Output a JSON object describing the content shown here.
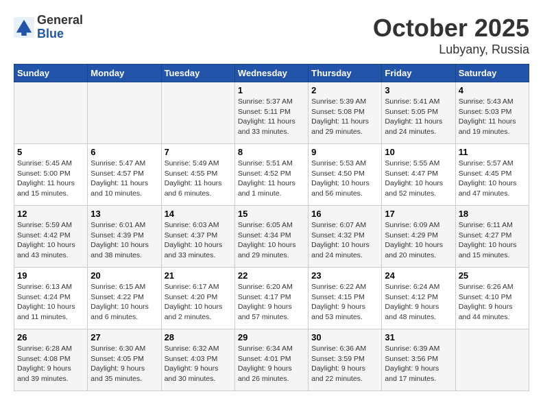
{
  "header": {
    "logo_line1": "General",
    "logo_line2": "Blue",
    "month": "October 2025",
    "location": "Lubyany, Russia"
  },
  "weekdays": [
    "Sunday",
    "Monday",
    "Tuesday",
    "Wednesday",
    "Thursday",
    "Friday",
    "Saturday"
  ],
  "weeks": [
    [
      {
        "day": "",
        "info": ""
      },
      {
        "day": "",
        "info": ""
      },
      {
        "day": "",
        "info": ""
      },
      {
        "day": "1",
        "info": "Sunrise: 5:37 AM\nSunset: 5:11 PM\nDaylight: 11 hours\nand 33 minutes."
      },
      {
        "day": "2",
        "info": "Sunrise: 5:39 AM\nSunset: 5:08 PM\nDaylight: 11 hours\nand 29 minutes."
      },
      {
        "day": "3",
        "info": "Sunrise: 5:41 AM\nSunset: 5:05 PM\nDaylight: 11 hours\nand 24 minutes."
      },
      {
        "day": "4",
        "info": "Sunrise: 5:43 AM\nSunset: 5:03 PM\nDaylight: 11 hours\nand 19 minutes."
      }
    ],
    [
      {
        "day": "5",
        "info": "Sunrise: 5:45 AM\nSunset: 5:00 PM\nDaylight: 11 hours\nand 15 minutes."
      },
      {
        "day": "6",
        "info": "Sunrise: 5:47 AM\nSunset: 4:57 PM\nDaylight: 11 hours\nand 10 minutes."
      },
      {
        "day": "7",
        "info": "Sunrise: 5:49 AM\nSunset: 4:55 PM\nDaylight: 11 hours\nand 6 minutes."
      },
      {
        "day": "8",
        "info": "Sunrise: 5:51 AM\nSunset: 4:52 PM\nDaylight: 11 hours\nand 1 minute."
      },
      {
        "day": "9",
        "info": "Sunrise: 5:53 AM\nSunset: 4:50 PM\nDaylight: 10 hours\nand 56 minutes."
      },
      {
        "day": "10",
        "info": "Sunrise: 5:55 AM\nSunset: 4:47 PM\nDaylight: 10 hours\nand 52 minutes."
      },
      {
        "day": "11",
        "info": "Sunrise: 5:57 AM\nSunset: 4:45 PM\nDaylight: 10 hours\nand 47 minutes."
      }
    ],
    [
      {
        "day": "12",
        "info": "Sunrise: 5:59 AM\nSunset: 4:42 PM\nDaylight: 10 hours\nand 43 minutes."
      },
      {
        "day": "13",
        "info": "Sunrise: 6:01 AM\nSunset: 4:39 PM\nDaylight: 10 hours\nand 38 minutes."
      },
      {
        "day": "14",
        "info": "Sunrise: 6:03 AM\nSunset: 4:37 PM\nDaylight: 10 hours\nand 33 minutes."
      },
      {
        "day": "15",
        "info": "Sunrise: 6:05 AM\nSunset: 4:34 PM\nDaylight: 10 hours\nand 29 minutes."
      },
      {
        "day": "16",
        "info": "Sunrise: 6:07 AM\nSunset: 4:32 PM\nDaylight: 10 hours\nand 24 minutes."
      },
      {
        "day": "17",
        "info": "Sunrise: 6:09 AM\nSunset: 4:29 PM\nDaylight: 10 hours\nand 20 minutes."
      },
      {
        "day": "18",
        "info": "Sunrise: 6:11 AM\nSunset: 4:27 PM\nDaylight: 10 hours\nand 15 minutes."
      }
    ],
    [
      {
        "day": "19",
        "info": "Sunrise: 6:13 AM\nSunset: 4:24 PM\nDaylight: 10 hours\nand 11 minutes."
      },
      {
        "day": "20",
        "info": "Sunrise: 6:15 AM\nSunset: 4:22 PM\nDaylight: 10 hours\nand 6 minutes."
      },
      {
        "day": "21",
        "info": "Sunrise: 6:17 AM\nSunset: 4:20 PM\nDaylight: 10 hours\nand 2 minutes."
      },
      {
        "day": "22",
        "info": "Sunrise: 6:20 AM\nSunset: 4:17 PM\nDaylight: 9 hours\nand 57 minutes."
      },
      {
        "day": "23",
        "info": "Sunrise: 6:22 AM\nSunset: 4:15 PM\nDaylight: 9 hours\nand 53 minutes."
      },
      {
        "day": "24",
        "info": "Sunrise: 6:24 AM\nSunset: 4:12 PM\nDaylight: 9 hours\nand 48 minutes."
      },
      {
        "day": "25",
        "info": "Sunrise: 6:26 AM\nSunset: 4:10 PM\nDaylight: 9 hours\nand 44 minutes."
      }
    ],
    [
      {
        "day": "26",
        "info": "Sunrise: 6:28 AM\nSunset: 4:08 PM\nDaylight: 9 hours\nand 39 minutes."
      },
      {
        "day": "27",
        "info": "Sunrise: 6:30 AM\nSunset: 4:05 PM\nDaylight: 9 hours\nand 35 minutes."
      },
      {
        "day": "28",
        "info": "Sunrise: 6:32 AM\nSunset: 4:03 PM\nDaylight: 9 hours\nand 30 minutes."
      },
      {
        "day": "29",
        "info": "Sunrise: 6:34 AM\nSunset: 4:01 PM\nDaylight: 9 hours\nand 26 minutes."
      },
      {
        "day": "30",
        "info": "Sunrise: 6:36 AM\nSunset: 3:59 PM\nDaylight: 9 hours\nand 22 minutes."
      },
      {
        "day": "31",
        "info": "Sunrise: 6:39 AM\nSunset: 3:56 PM\nDaylight: 9 hours\nand 17 minutes."
      },
      {
        "day": "",
        "info": ""
      }
    ]
  ]
}
